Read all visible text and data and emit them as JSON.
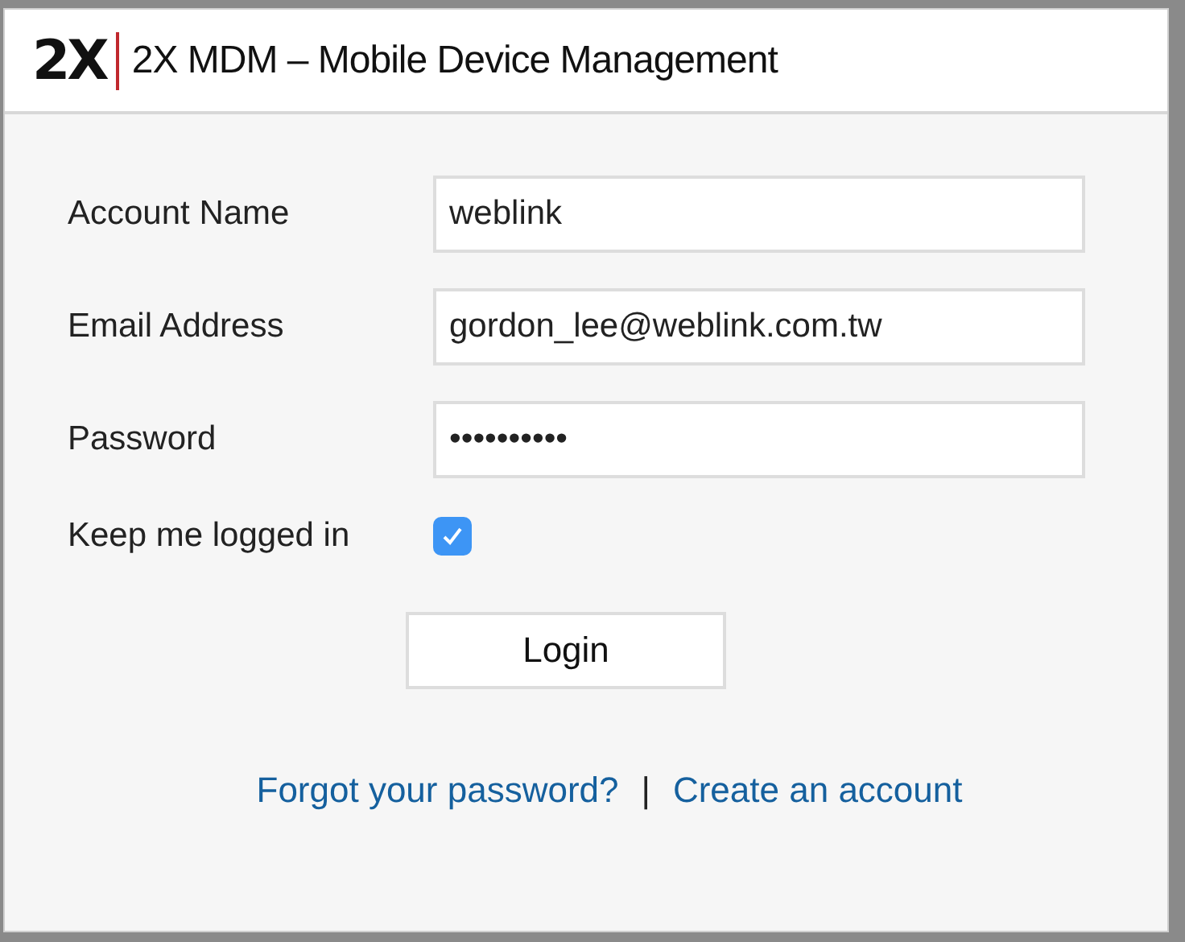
{
  "header": {
    "logo": "2X",
    "title": "2X MDM – Mobile Device Management"
  },
  "fields": [
    {
      "label": "Account Name",
      "value": "weblink"
    },
    {
      "label": "Email Address",
      "value": "gordon_lee@weblink.com.tw"
    },
    {
      "label": "Password",
      "value": "••••••••••"
    }
  ],
  "remember": {
    "label": "Keep me logged in",
    "checked": true
  },
  "login_button": "Login",
  "links": [
    {
      "label": "Forgot your password?"
    },
    {
      "label": "Create an account"
    }
  ],
  "link_separator": "|"
}
